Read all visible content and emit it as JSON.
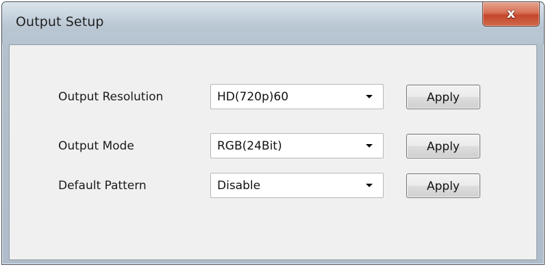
{
  "window": {
    "title": "Output Setup",
    "close_glyph": "x"
  },
  "settings": {
    "rows": [
      {
        "label": "Output Resolution",
        "value": "HD(720p)60",
        "apply_label": "Apply"
      },
      {
        "label": "Output Mode",
        "value": "RGB(24Bit)",
        "apply_label": "Apply"
      },
      {
        "label": "Default Pattern",
        "value": "Disable",
        "apply_label": "Apply"
      }
    ]
  },
  "icons": {
    "close": "close-icon",
    "dropdown": "chevron-down-icon"
  },
  "colors": {
    "titlebar": "#c6d2dd",
    "client_background": "#f0f0f0",
    "close_button": "#c5462c",
    "button_face": "#e6e6e6"
  }
}
